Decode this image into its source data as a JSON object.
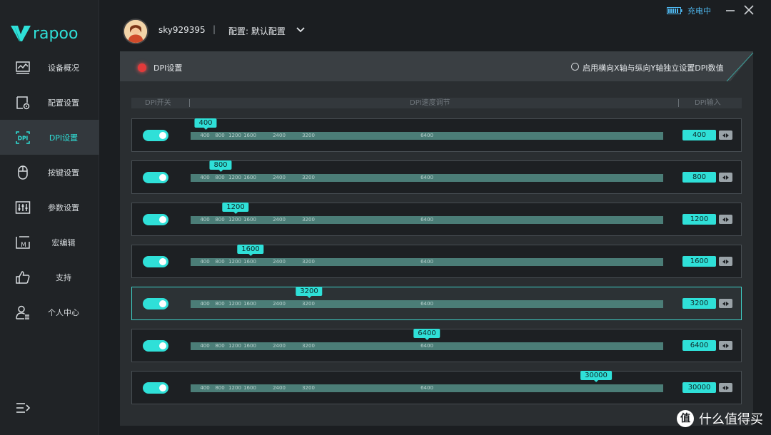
{
  "app": {
    "brand": "rapoo"
  },
  "sidebar": {
    "items": [
      {
        "label": "设备概况",
        "icon": "chart-monitor-icon"
      },
      {
        "label": "配置设置",
        "icon": "config-settings-icon"
      },
      {
        "label": "DPI设置",
        "icon": "dpi-icon",
        "active": true
      },
      {
        "label": "按键设置",
        "icon": "mouse-icon"
      },
      {
        "label": "参数设置",
        "icon": "sliders-icon"
      },
      {
        "label": "宏编辑",
        "icon": "macro-icon"
      },
      {
        "label": "支持",
        "icon": "thumbs-up-icon"
      },
      {
        "label": "个人中心",
        "icon": "user-profile-icon"
      }
    ],
    "menu_icon": "collapse-menu-icon"
  },
  "topbar": {
    "username": "sky929395",
    "separator": "|",
    "config_label": "配置: 默认配置",
    "charging_status": "充电中"
  },
  "panel": {
    "title": "DPI设置",
    "xy_option_label": "启用横向X轴与纵向Y轴独立设置DPI数值",
    "columns": {
      "switch": "DPI开关",
      "speed": "DPI速度调节",
      "input": "DPI输入"
    },
    "tick_labels": [
      "400",
      "800",
      "1200",
      "1600",
      "2400",
      "3200",
      "6400"
    ],
    "rows": [
      {
        "value": "400",
        "enabled": true,
        "selected": false
      },
      {
        "value": "800",
        "enabled": true,
        "selected": false
      },
      {
        "value": "1200",
        "enabled": true,
        "selected": false
      },
      {
        "value": "1600",
        "enabled": true,
        "selected": false
      },
      {
        "value": "3200",
        "enabled": true,
        "selected": true
      },
      {
        "value": "6400",
        "enabled": true,
        "selected": false
      },
      {
        "value": "30000",
        "enabled": true,
        "selected": false
      }
    ]
  },
  "watermark": {
    "logo": "值",
    "text": "什么值得买"
  },
  "colors": {
    "accent": "#2fe0d8",
    "track": "#4b7d77",
    "record": "#e23a3a",
    "charging": "#4fb8f0"
  }
}
